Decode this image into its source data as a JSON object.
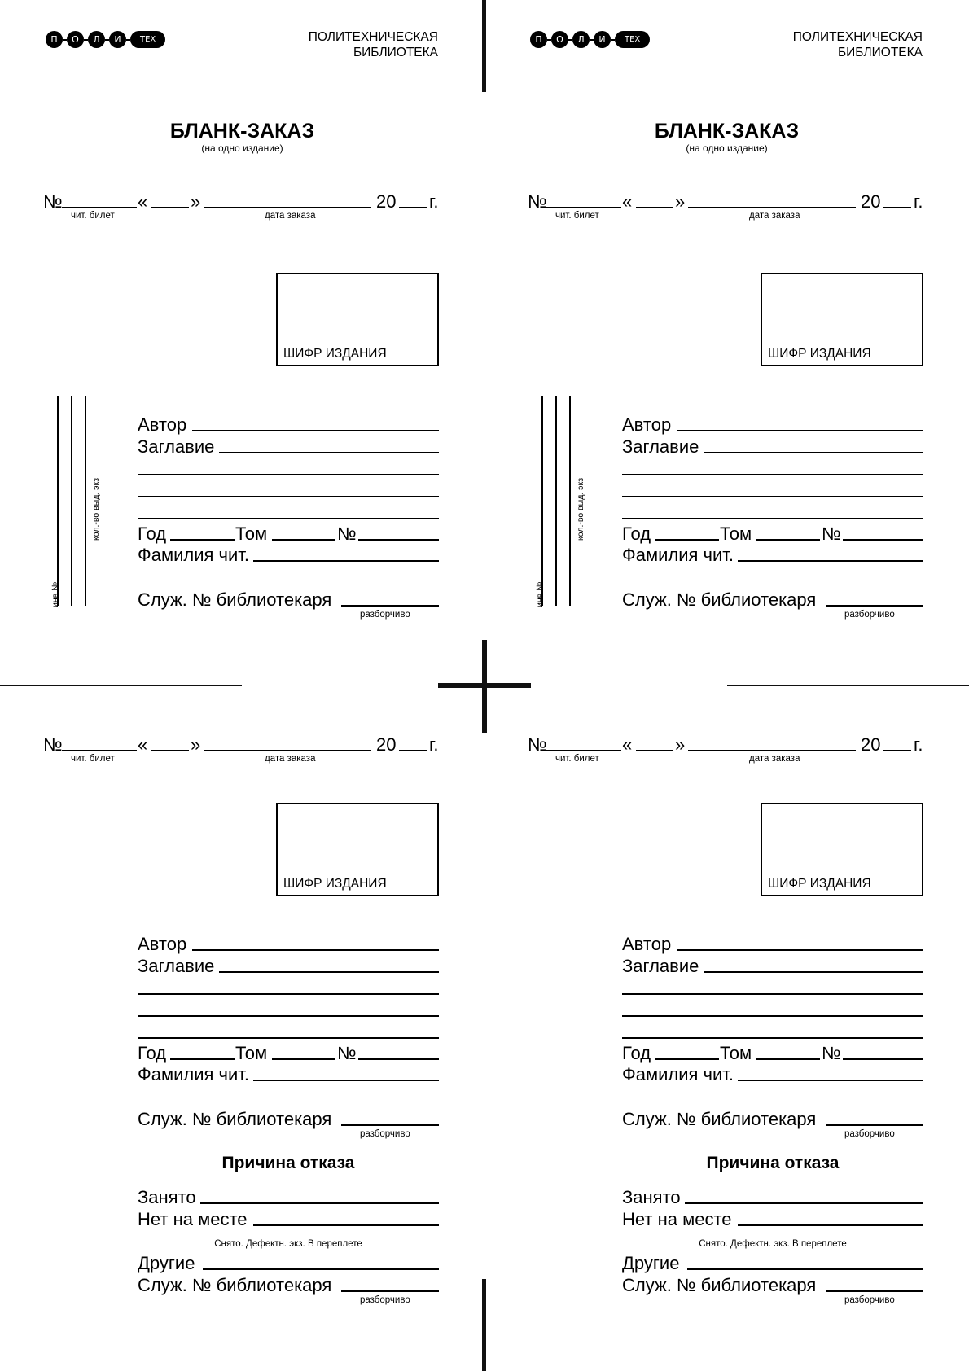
{
  "logo": {
    "letters": [
      "П",
      "О",
      "Л",
      "И"
    ],
    "pill": "ТЕХ"
  },
  "library_name": [
    "ПОЛИТЕХНИЧЕСКАЯ",
    "БИБЛИОТЕКА"
  ],
  "form": {
    "title": "БЛАНК-ЗАКАЗ",
    "subtitle": "(на одно издание)",
    "number_sign": "№",
    "quote_open": "«",
    "quote_close": "»",
    "year_prefix": "20",
    "year_suffix": "г.",
    "ticket_caption": "чит. билет",
    "date_caption": "дата заказа",
    "cipher_label": "ШИФР ИЗДАНИЯ",
    "inv_label": "инв №",
    "qty_label": "кол.-во выд. экз",
    "author": "Автор",
    "title_field": "Заглавие",
    "year": "Год",
    "volume": "Том",
    "issue": "№",
    "reader_surname": "Фамилия чит.",
    "librarian": "Служ. № библиотекаря",
    "legibly": "разборчиво"
  },
  "refusal": {
    "heading": "Причина отказа",
    "busy": "Занято",
    "missing": "Нет на месте",
    "hint": "Снято.  Дефектн. экз.  В переплете",
    "other": "Другие",
    "librarian": "Служ. № библиотекаря",
    "legibly": "разборчиво"
  }
}
